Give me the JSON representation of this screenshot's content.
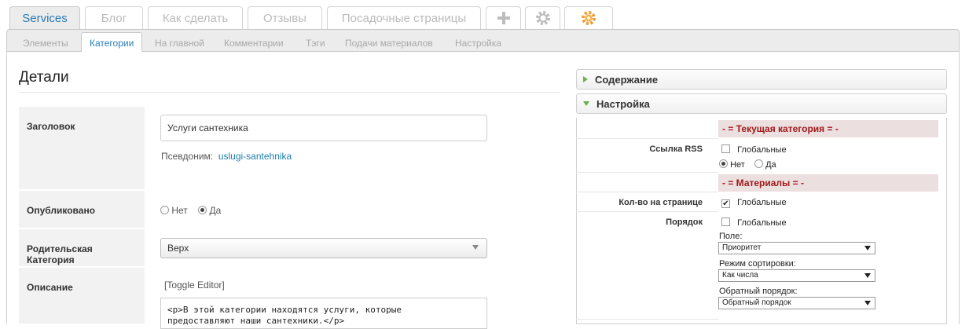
{
  "top_tabs": [
    {
      "label": "Services",
      "active": true
    },
    {
      "label": "Блог"
    },
    {
      "label": "Как сделать"
    },
    {
      "label": "Отзывы"
    },
    {
      "label": "Посадочные страницы"
    }
  ],
  "icon_tabs": [
    "plus-icon",
    "gear-icon",
    "component-gear-icon"
  ],
  "sub_tabs": [
    {
      "label": "Элементы"
    },
    {
      "label": "Категории",
      "active": true
    },
    {
      "label": "На главной"
    },
    {
      "label": "Комментарии"
    },
    {
      "label": "Тэги"
    },
    {
      "label": "Подачи материалов"
    },
    {
      "label": "Настройка"
    }
  ],
  "details": {
    "title": "Детали",
    "title_field": {
      "label": "Заголовок",
      "value": "Услуги сантехника",
      "alias_label": "Псевдоним:",
      "alias_value": "uslugi-santehnika"
    },
    "published": {
      "label": "Опубликовано",
      "opt_no": "Нет",
      "opt_yes": "Да",
      "selected": "Да"
    },
    "parent": {
      "label": "Родительская Категория",
      "value": "Верх"
    },
    "description": {
      "label": "Описание",
      "toggle": "[Toggle Editor]",
      "line1": "<p>В этой категории находятся услуги, которые",
      "line2": "предоставляют наши сантехники.</p>"
    }
  },
  "accordion": {
    "content_label": "Содержание",
    "settings_label": "Настройка"
  },
  "settings": {
    "section_current": "- = Текущая категория = -",
    "rss_label": "Ссылка RSS",
    "rss_global": "Глобальные",
    "rss_no": "Нет",
    "rss_yes": "Да",
    "section_materials": "- = Материалы = -",
    "per_page_label": "Кол-во на странице",
    "per_page_global": "Глобальные",
    "order_label": "Порядок",
    "order_global": "Глобальные",
    "field_label": "Поле:",
    "field_value": "Приоритет",
    "sort_mode_label": "Режим сортировки:",
    "sort_mode_value": "Как числа",
    "reverse_label": "Обратный порядок:",
    "reverse_value": "Обратный порядок"
  }
}
